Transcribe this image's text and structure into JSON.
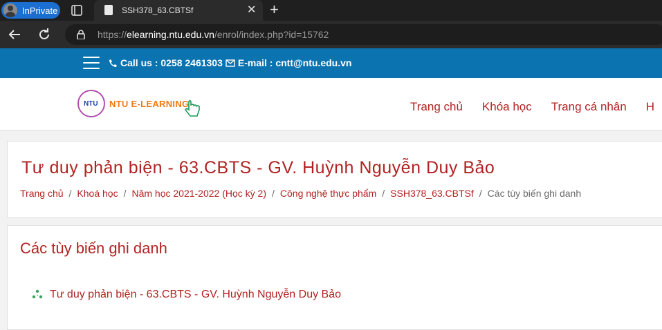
{
  "browser": {
    "inprivate_label": "InPrivate",
    "tab_title": "SSH378_63.CBTSf",
    "close_glyph": "✕",
    "newtab_glyph": "+",
    "url_prefix": "https://",
    "url_host": "elearning.ntu.edu.vn",
    "url_path": "/enrol/index.php?id=15762"
  },
  "site": {
    "contact_text": "Call us : 0258 2461303",
    "email_text": "E-mail : cntt@ntu.edu.vn",
    "logo_mark": "NTU",
    "logo_text": "NTU E-LEARNING",
    "nav": [
      "Trang chủ",
      "Khóa học",
      "Trang cá nhân",
      "H"
    ],
    "brand_color": "#0b73b0",
    "accent_color": "#b22222"
  },
  "page": {
    "title": "Tư duy phản biện - 63.CBTS - GV. Huỳnh Nguyễn Duy Bảo",
    "breadcrumb": [
      "Trang chủ",
      "Khoá học",
      "Năm học 2021-2022 (Học kỳ 2)",
      "Công nghệ thực phẩm",
      "SSH378_63.CBTSf"
    ],
    "breadcrumb_current": "Các tùy biến ghi danh",
    "section_title": "Các tùy biến ghi danh",
    "course_link": "Tư duy phản biện - 63.CBTS - GV. Huỳnh Nguyễn Duy Bảo",
    "course_link_2": "... ... ..."
  }
}
